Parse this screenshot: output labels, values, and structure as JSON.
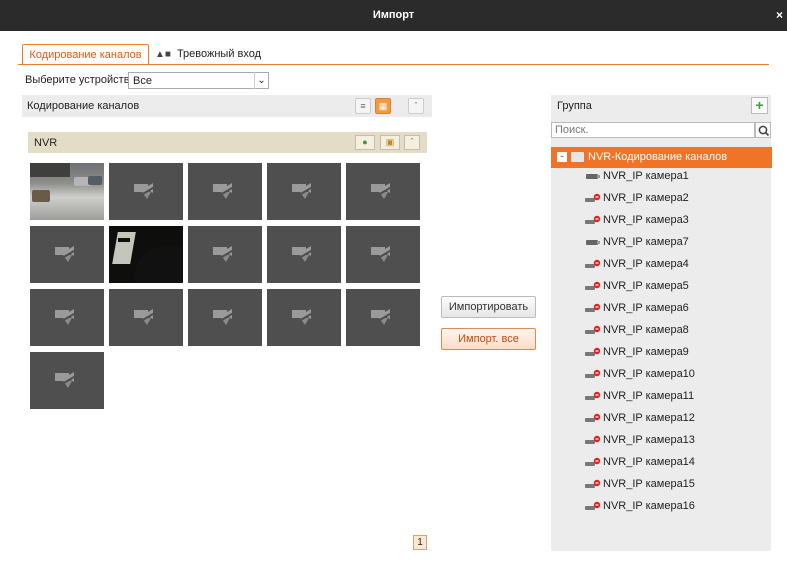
{
  "window": {
    "title": "Импорт",
    "close": "×"
  },
  "tabs": [
    {
      "label": "Кодирование каналов",
      "active": true
    },
    {
      "label": "Тревожный вход",
      "active": false,
      "icon": "alarm-input-icon"
    }
  ],
  "device": {
    "label": "Выберите устройство",
    "value": "Все"
  },
  "left_panel": {
    "title": "Кодирование каналов",
    "device_name": "NVR",
    "channels": [
      {
        "state": "live-street"
      },
      {
        "state": "offline"
      },
      {
        "state": "offline"
      },
      {
        "state": "offline"
      },
      {
        "state": "offline"
      },
      {
        "state": "offline"
      },
      {
        "state": "live-indoor"
      },
      {
        "state": "offline"
      },
      {
        "state": "offline"
      },
      {
        "state": "offline"
      },
      {
        "state": "offline"
      },
      {
        "state": "offline"
      },
      {
        "state": "offline"
      },
      {
        "state": "offline"
      },
      {
        "state": "offline"
      },
      {
        "state": "offline"
      }
    ],
    "page": "1"
  },
  "actions": {
    "import": "Импортировать",
    "import_all": "Импорт. все"
  },
  "right_panel": {
    "title": "Группа",
    "search_placeholder": "Поиск.",
    "root": "NVR-Кодирование каналов",
    "cameras": [
      {
        "label": "NVR_IP камера1",
        "status": "online"
      },
      {
        "label": "NVR_IP камера2",
        "status": "offline"
      },
      {
        "label": "NVR_IP камера3",
        "status": "offline"
      },
      {
        "label": "NVR_IP камера7",
        "status": "online"
      },
      {
        "label": "NVR_IP камера4",
        "status": "offline"
      },
      {
        "label": "NVR_IP камера5",
        "status": "offline"
      },
      {
        "label": "NVR_IP камера6",
        "status": "offline"
      },
      {
        "label": "NVR_IP камера8",
        "status": "offline"
      },
      {
        "label": "NVR_IP камера9",
        "status": "offline"
      },
      {
        "label": "NVR_IP камера10",
        "status": "offline"
      },
      {
        "label": "NVR_IP камера11",
        "status": "offline"
      },
      {
        "label": "NVR_IP камера12",
        "status": "offline"
      },
      {
        "label": "NVR_IP камера13",
        "status": "offline"
      },
      {
        "label": "NVR_IP камера14",
        "status": "offline"
      },
      {
        "label": "NVR_IP камера15",
        "status": "offline"
      },
      {
        "label": "NVR_IP камера16",
        "status": "offline"
      }
    ]
  },
  "colors": {
    "accent": "#f07428",
    "titlebar": "#2b2b2b",
    "nvr_bar": "#e3dcc6",
    "tile": "#4f4f4f"
  }
}
